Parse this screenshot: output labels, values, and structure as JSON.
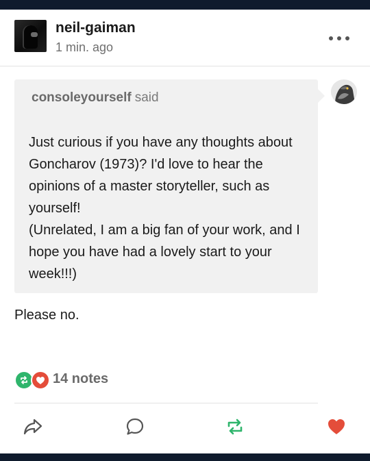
{
  "post": {
    "author": "neil-gaiman",
    "timestamp": "1 min. ago",
    "ask": {
      "asker": "consoleyourself",
      "said": "said",
      "question": "Just curious if you have any thoughts about Goncharov (1973)?  I'd love to hear the opinions of a master storyteller, such as yourself!\n(Unrelated, I am a big fan of your work, and I hope you have had a lovely start to your week!!!)"
    },
    "answer": "Please no.",
    "notes": "14 notes"
  },
  "icons": {
    "more": "more-horizontal-icon",
    "share": "share-icon",
    "reply": "reply-icon",
    "reblog": "reblog-icon",
    "like": "heart-icon"
  },
  "colors": {
    "reblog_green": "#2fb56c",
    "like_red": "#e44d3a",
    "header_bar": "#0f1b2d",
    "ask_bg": "#f1f1f1"
  }
}
